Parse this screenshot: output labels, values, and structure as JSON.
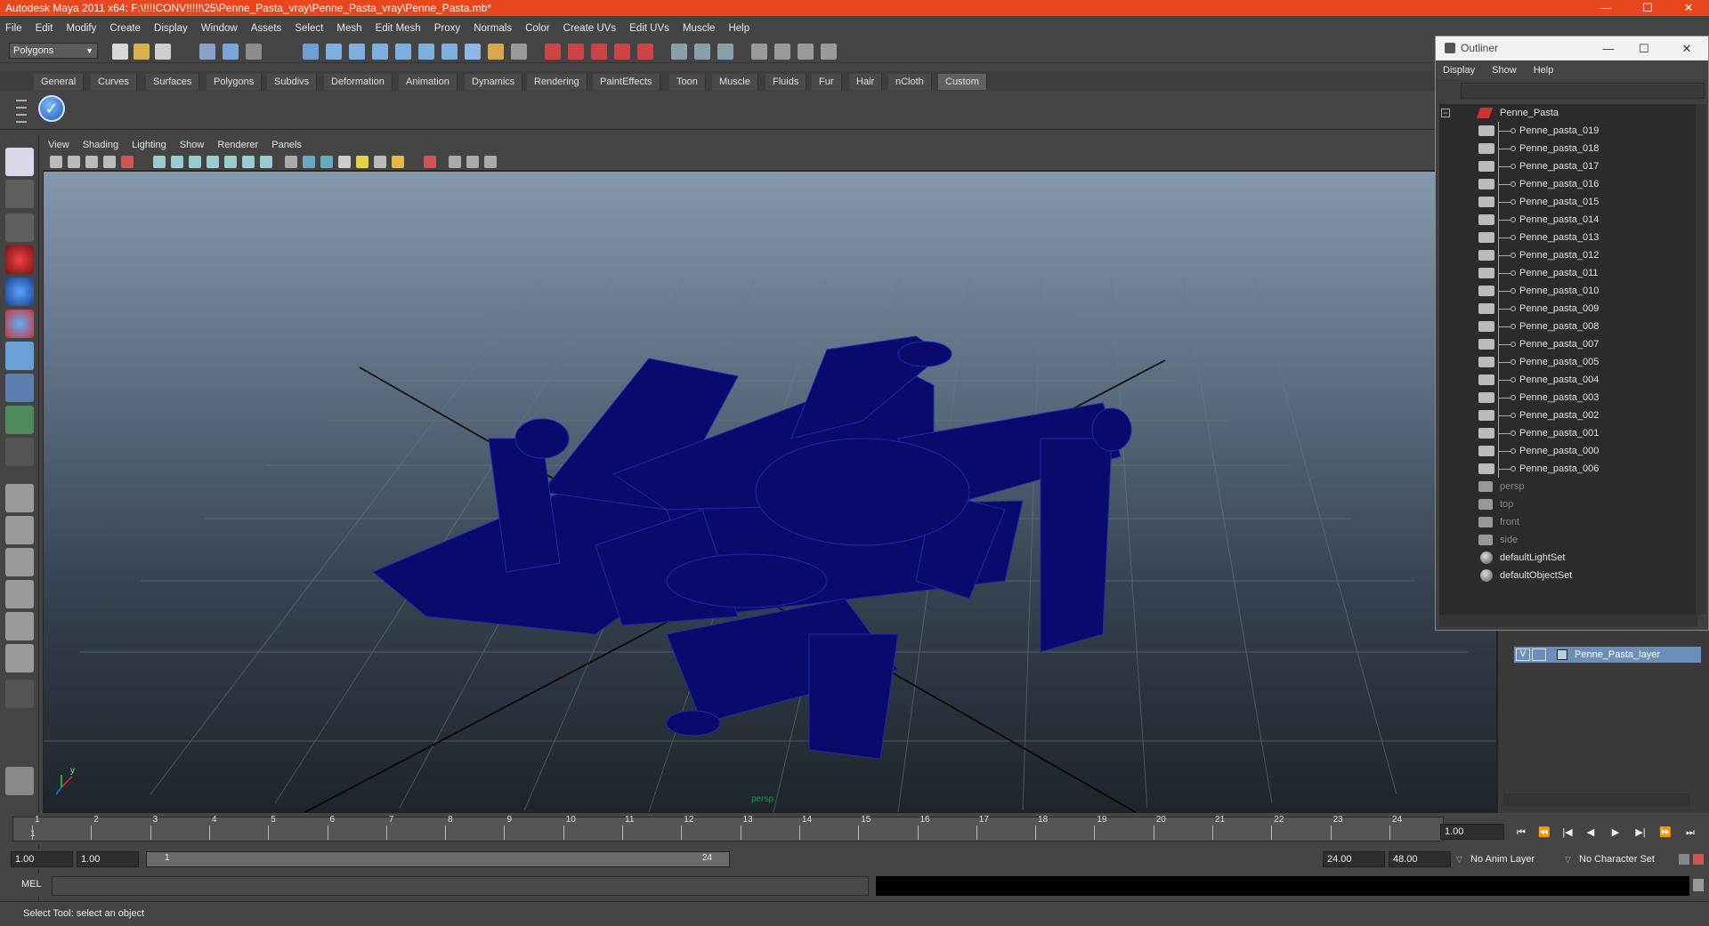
{
  "window": {
    "title": "Autodesk Maya 2011 x64: F:\\!!!!CONV!!!!!\\25\\Penne_Pasta_vray\\Penne_Pasta_vray\\Penne_Pasta.mb*",
    "minimize": "—",
    "maximize": "☐",
    "close": "✕"
  },
  "menubar": [
    "File",
    "Edit",
    "Modify",
    "Create",
    "Display",
    "Window",
    "Assets",
    "Select",
    "Mesh",
    "Edit Mesh",
    "Proxy",
    "Normals",
    "Color",
    "Create UVs",
    "Edit UVs",
    "Muscle",
    "Help"
  ],
  "statusline": {
    "mode": "Polygons",
    "mode_arrow": "▼"
  },
  "shelf": {
    "tabs": [
      "General",
      "Curves",
      "Surfaces",
      "Polygons",
      "Subdivs",
      "Deformation",
      "Animation",
      "Dynamics",
      "Rendering",
      "PaintEffects",
      "Toon",
      "Muscle",
      "Fluids",
      "Fur",
      "Hair",
      "nCloth",
      "Custom"
    ],
    "active_tab": "Custom",
    "check_icon": "✓"
  },
  "panel": {
    "menu": [
      "View",
      "Shading",
      "Lighting",
      "Show",
      "Renderer",
      "Panels"
    ],
    "camera": "persp",
    "axis_label": "y",
    "wire_color": "#0a0a6e"
  },
  "outliner": {
    "title": "Outliner",
    "menu": [
      "Display",
      "Show",
      "Help"
    ],
    "root": "Penne_Pasta",
    "items": [
      "Penne_pasta_019",
      "Penne_pasta_018",
      "Penne_pasta_017",
      "Penne_pasta_016",
      "Penne_pasta_015",
      "Penne_pasta_014",
      "Penne_pasta_013",
      "Penne_pasta_012",
      "Penne_pasta_011",
      "Penne_pasta_010",
      "Penne_pasta_009",
      "Penne_pasta_008",
      "Penne_pasta_007",
      "Penne_pasta_005",
      "Penne_pasta_004",
      "Penne_pasta_003",
      "Penne_pasta_002",
      "Penne_pasta_001",
      "Penne_pasta_000",
      "Penne_pasta_006"
    ],
    "cameras": [
      "persp",
      "top",
      "front",
      "side"
    ],
    "sets": [
      "defaultLightSet",
      "defaultObjectSet"
    ],
    "minimize": "—",
    "maximize": "☐",
    "close": "✕"
  },
  "layer_editor": {
    "layer_name": "Penne_Pasta_layer",
    "visible": "V"
  },
  "timeslider": {
    "ticks": [
      "1",
      "2",
      "3",
      "4",
      "5",
      "6",
      "7",
      "8",
      "9",
      "10",
      "11",
      "12",
      "13",
      "14",
      "15",
      "16",
      "17",
      "18",
      "19",
      "20",
      "21",
      "22",
      "23",
      "24"
    ],
    "start_marker": "1",
    "current_frame": "1.00",
    "buttons": [
      "⏮",
      "⏪",
      "|◀",
      "◀",
      "▶",
      "▶|",
      "⏩",
      "⏭"
    ]
  },
  "rangeslider": {
    "start": "1.00",
    "anim_start": "1.00",
    "range_start": "1",
    "range_end": "24",
    "anim_end": "24.00",
    "end": "48.00",
    "anim_layer": "No Anim Layer",
    "character_set": "No Character Set"
  },
  "cmdline": {
    "label": "MEL"
  },
  "helpline": {
    "text": "Select Tool: select an object"
  }
}
